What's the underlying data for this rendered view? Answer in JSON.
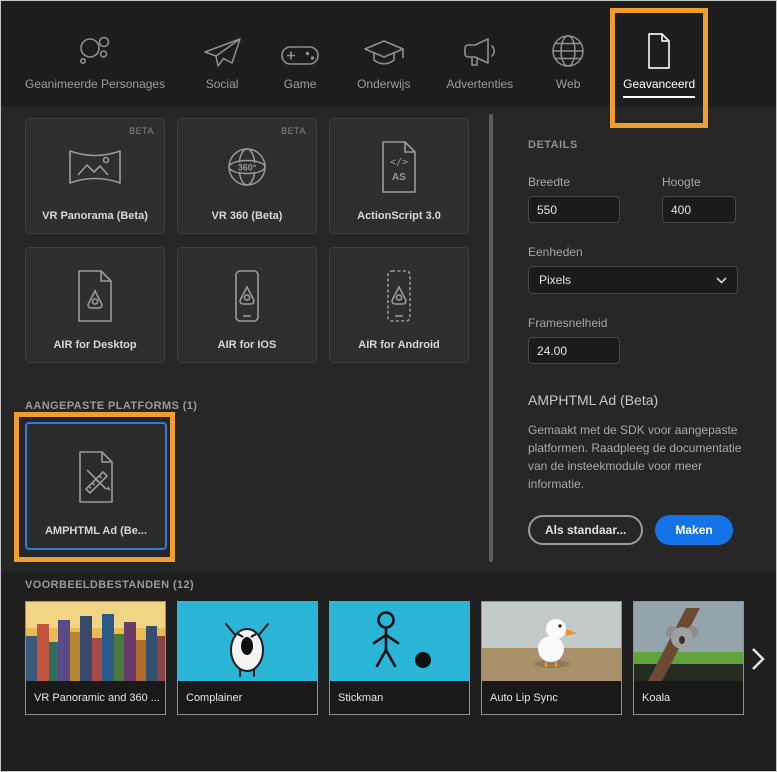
{
  "colors": {
    "highlight_orange": "#EF9D2E",
    "primary_blue": "#1473E6",
    "selection_blue": "#2B80D9"
  },
  "tabs": [
    {
      "label": "Geanimeerde Personages",
      "icon": "animated-characters-icon",
      "active": false
    },
    {
      "label": "Social",
      "icon": "paper-plane-icon",
      "active": false
    },
    {
      "label": "Game",
      "icon": "gamepad-icon",
      "active": false
    },
    {
      "label": "Onderwijs",
      "icon": "graduation-cap-icon",
      "active": false
    },
    {
      "label": "Advertenties",
      "icon": "megaphone-icon",
      "active": false
    },
    {
      "label": "Web",
      "icon": "globe-icon",
      "active": false
    },
    {
      "label": "Geavanceerd",
      "icon": "document-icon",
      "active": true
    }
  ],
  "presets": [
    {
      "label": "VR Panorama (Beta)",
      "badge": "BETA",
      "icon": "vr-panorama-icon"
    },
    {
      "label": "VR 360 (Beta)",
      "badge": "BETA",
      "icon": "vr-360-icon"
    },
    {
      "label": "ActionScript 3.0",
      "icon": "actionscript-document-icon"
    },
    {
      "label": "AIR for Desktop",
      "icon": "air-desktop-icon"
    },
    {
      "label": "AIR for IOS",
      "icon": "air-ios-icon"
    },
    {
      "label": "AIR for Android",
      "icon": "air-android-icon"
    }
  ],
  "custom_platforms": {
    "heading": "AANGEPASTE PLATFORMS (1)",
    "card": {
      "label": "AMPHTML Ad (Be...",
      "icon": "amphtml-ad-icon",
      "selected": true
    }
  },
  "details": {
    "heading": "DETAILS",
    "width_label": "Breedte",
    "width_value": "550",
    "height_label": "Hoogte",
    "height_value": "400",
    "units_label": "Eenheden",
    "units_value": "Pixels",
    "framerate_label": "Framesnelheid",
    "framerate_value": "24.00",
    "preset_title": "AMPHTML Ad (Beta)",
    "description": "Gemaakt met de SDK voor aangepaste platformen. Raadpleeg de documentatie van de insteekmodule voor meer informatie.",
    "default_button_label": "Als standaar...",
    "create_button_label": "Maken"
  },
  "samples": {
    "heading": "VOORBEELDBESTANDEN (12)",
    "items": [
      {
        "label": "VR Panoramic and 360 ...",
        "thumbnail": "city-skyline"
      },
      {
        "label": "Complainer",
        "thumbnail": "crying-character"
      },
      {
        "label": "Stickman",
        "thumbnail": "stick-figure"
      },
      {
        "label": "Auto Lip Sync",
        "thumbnail": "bird-on-beach"
      },
      {
        "label": "Koala",
        "thumbnail": "koala-on-tree"
      }
    ],
    "next_arrow": "chevron-right-icon"
  }
}
